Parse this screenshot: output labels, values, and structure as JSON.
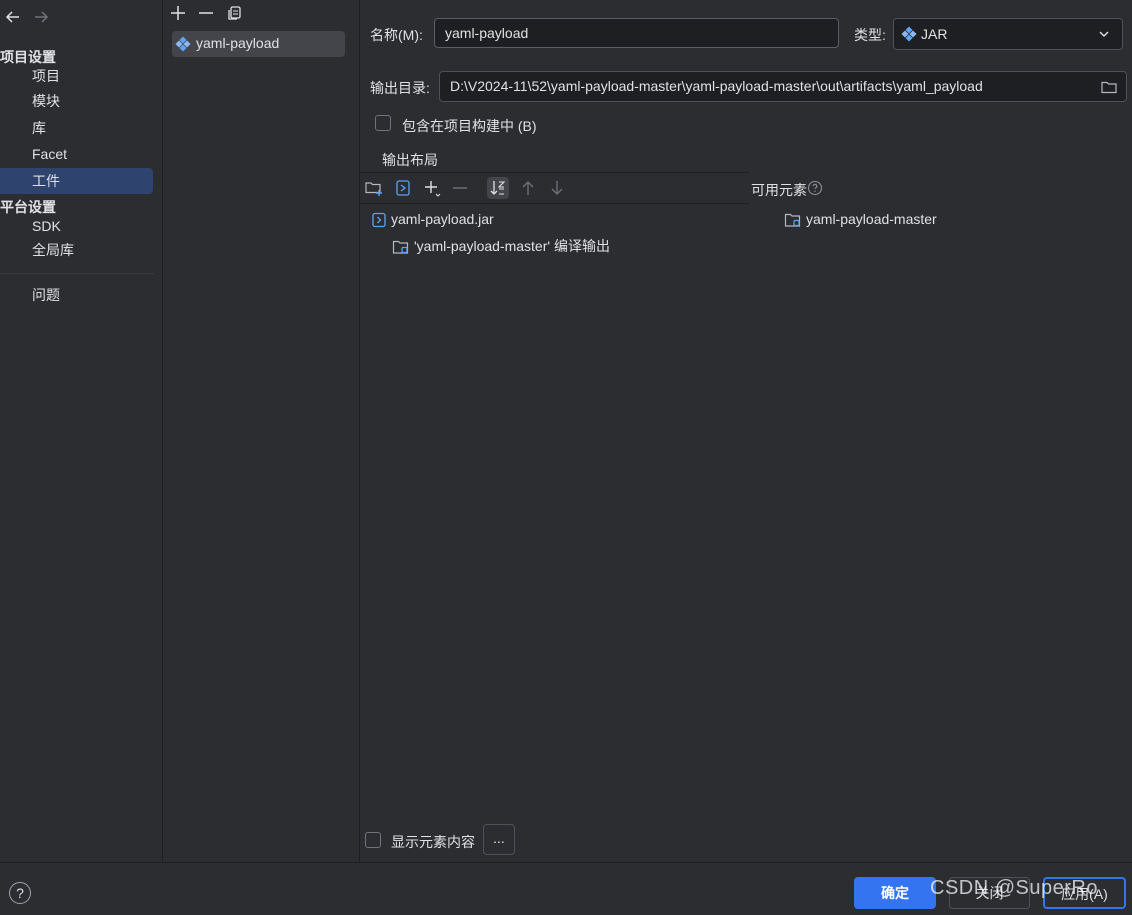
{
  "nav": {
    "project_settings": "项目设置",
    "project_items": [
      "项目",
      "模块",
      "库",
      "Facet",
      "工件"
    ],
    "platform_settings": "平台设置",
    "platform_items": [
      "SDK",
      "全局库"
    ],
    "problems": "问题",
    "selected": "工件"
  },
  "artifacts": {
    "items": [
      "yaml-payload"
    ]
  },
  "form": {
    "name_label": "名称(M):",
    "name_value": "yaml-payload",
    "type_label": "类型:",
    "type_value": "JAR",
    "outdir_label": "输出目录:",
    "outdir_value": "D:\\V2024-11\\52\\yaml-payload-master\\yaml-payload-master\\out\\artifacts\\yaml_payload",
    "include_build_label": "包含在项目构建中 (B)",
    "include_build_checked": false
  },
  "layout": {
    "title": "输出布局",
    "available_label": "可用元素",
    "tree": [
      {
        "label": "yaml-payload.jar",
        "icon": "jar-icon"
      },
      {
        "label": "'yaml-payload-master' 编译输出",
        "icon": "module-folder-icon"
      }
    ],
    "available": [
      {
        "label": "yaml-payload-master",
        "icon": "module-folder-icon"
      }
    ],
    "show_content_label": "显示元素内容",
    "show_content_checked": false,
    "more_label": "..."
  },
  "footer": {
    "help": "?",
    "ok": "确定",
    "cancel": "关闭",
    "apply": "应用(A)",
    "watermark": "CSDN @SuperRo"
  },
  "colors": {
    "background": "#2b2d30",
    "selection": "#2e436e",
    "accent": "#3574f0",
    "artifact_icon": "#5ea3f5"
  }
}
